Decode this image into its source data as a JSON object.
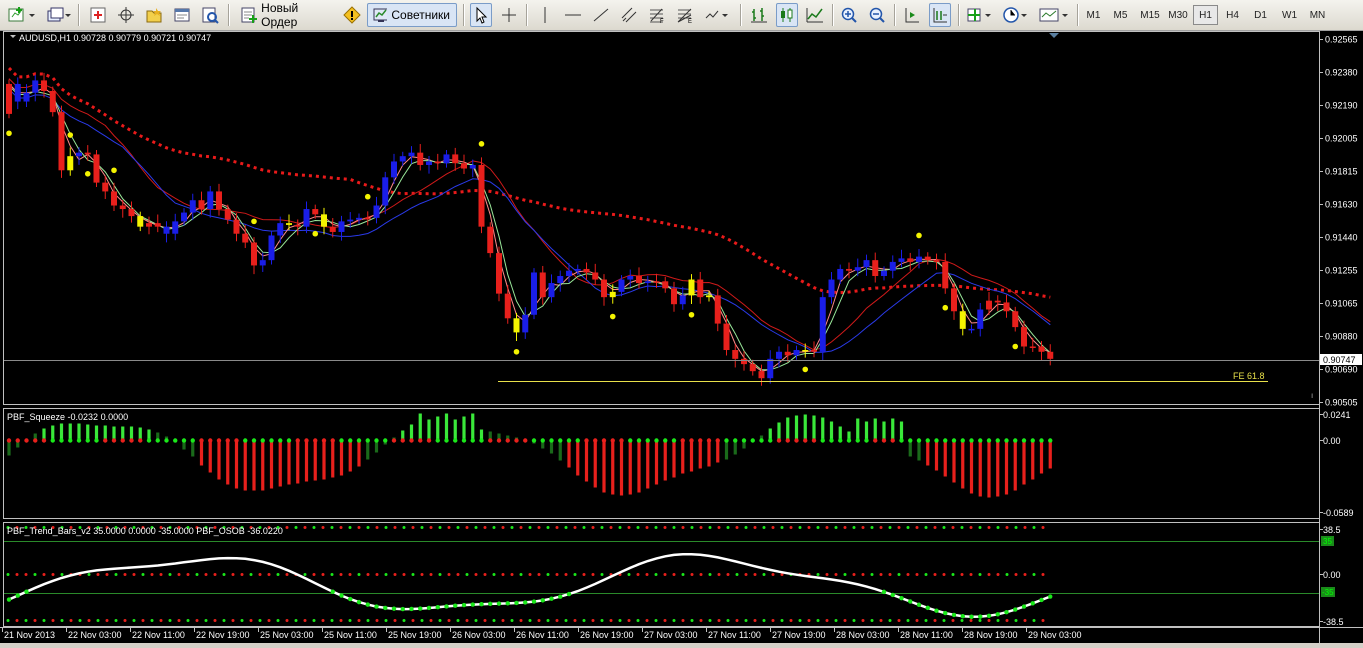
{
  "toolbar": {
    "new_order_label": "Новый Ордер",
    "advisors_label": "Советники",
    "timeframes": [
      "M1",
      "M5",
      "M15",
      "M30",
      "H1",
      "H4",
      "D1",
      "W1",
      "MN"
    ],
    "active_timeframe": "H1"
  },
  "main_chart": {
    "header": "AUDUSD,H1  0.90728 0.90779 0.90721 0.90747",
    "price_ticks": [
      "0.92565",
      "0.92380",
      "0.92190",
      "0.92005",
      "0.91815",
      "0.91630",
      "0.91440",
      "0.91255",
      "0.91065",
      "0.90880",
      "0.90690",
      "0.90505"
    ],
    "current_price": "0.90747",
    "fib_label": "FE 61.8",
    "candles_o": [
      0.9214,
      0.9231,
      0.9221,
      0.9226,
      0.9233,
      0.9227,
      0.9215,
      0.9182,
      0.919,
      0.9192,
      0.9191,
      0.9175,
      0.917,
      0.9162,
      0.916,
      0.9156,
      0.915,
      0.9152,
      0.915,
      0.9146,
      0.9153,
      0.9158,
      0.9165,
      0.916,
      0.917,
      0.916,
      0.9154,
      0.9146,
      0.9141,
      0.9128,
      0.9131,
      0.9145,
      0.9152,
      0.9151,
      0.915,
      0.916,
      0.9157,
      0.915,
      0.9147,
      0.9153,
      0.9154,
      0.9155,
      0.9155,
      0.9162,
      0.9178,
      0.9187,
      0.919,
      0.9192,
      0.9185,
      0.9187,
      0.9186,
      0.9191,
      0.9186,
      0.9183,
      0.9185,
      0.915,
      0.9135,
      0.9112,
      0.9098,
      0.909,
      0.91,
      0.9124,
      0.911,
      0.9118,
      0.9122,
      0.9125,
      0.9126,
      0.9124,
      0.912,
      0.911,
      0.9113,
      0.912,
      0.9122,
      0.9118,
      0.9119,
      0.9119,
      0.9115,
      0.9106,
      0.9111,
      0.912,
      0.911,
      0.9111,
      0.9095,
      0.908,
      0.9075,
      0.9072,
      0.9068,
      0.9064,
      0.9075,
      0.9079,
      0.9077,
      0.908,
      0.908,
      0.9079,
      0.911,
      0.912,
      0.9126,
      0.9125,
      0.9127,
      0.9131,
      0.9122,
      0.9125,
      0.913,
      0.9132,
      0.913,
      0.9133,
      0.9131,
      0.913,
      0.9115,
      0.9102,
      0.9092,
      0.9092,
      0.9103,
      0.9108,
      0.9107,
      0.9102,
      0.9093,
      0.9082,
      0.9082,
      0.9079
    ],
    "candles_c": [
      0.9231,
      0.9221,
      0.9226,
      0.9233,
      0.9227,
      0.9215,
      0.9182,
      0.919,
      0.9192,
      0.9191,
      0.9175,
      0.917,
      0.9162,
      0.916,
      0.9156,
      0.915,
      0.9152,
      0.915,
      0.9146,
      0.9153,
      0.9158,
      0.9165,
      0.916,
      0.917,
      0.916,
      0.9154,
      0.9146,
      0.9141,
      0.9128,
      0.9131,
      0.9145,
      0.9152,
      0.9151,
      0.915,
      0.916,
      0.9157,
      0.915,
      0.9147,
      0.9153,
      0.9154,
      0.9155,
      0.9155,
      0.9162,
      0.9178,
      0.9187,
      0.919,
      0.9192,
      0.9185,
      0.9187,
      0.9186,
      0.9191,
      0.9186,
      0.9183,
      0.9185,
      0.915,
      0.9135,
      0.9112,
      0.9098,
      0.909,
      0.91,
      0.9124,
      0.911,
      0.9118,
      0.9122,
      0.9125,
      0.9126,
      0.9124,
      0.912,
      0.911,
      0.9113,
      0.912,
      0.9122,
      0.9118,
      0.9119,
      0.9119,
      0.9115,
      0.9106,
      0.9111,
      0.912,
      0.911,
      0.9111,
      0.9095,
      0.908,
      0.9075,
      0.9072,
      0.9068,
      0.9064,
      0.9075,
      0.9079,
      0.9077,
      0.908,
      0.908,
      0.9079,
      0.911,
      0.912,
      0.9126,
      0.9125,
      0.9127,
      0.9131,
      0.9122,
      0.9125,
      0.913,
      0.9132,
      0.913,
      0.9133,
      0.9131,
      0.913,
      0.9115,
      0.9102,
      0.9092,
      0.9092,
      0.9103,
      0.9108,
      0.9107,
      0.9102,
      0.9093,
      0.9082,
      0.9082,
      0.9079,
      0.9075
    ],
    "candle_color": [
      "red",
      "blue",
      "blue",
      "blue",
      "red",
      "red",
      "red",
      "blue",
      "blue",
      "red",
      "red",
      "red",
      "red",
      "red",
      "red",
      "blue",
      "red",
      "red",
      "blue",
      "blue",
      "blue",
      "blue",
      "red",
      "blue",
      "red",
      "red",
      "red",
      "red",
      "red",
      "blue",
      "blue",
      "blue",
      "red",
      "red",
      "blue",
      "red",
      "red",
      "red",
      "blue",
      "blue",
      "blue",
      "red",
      "blue",
      "blue",
      "blue",
      "blue",
      "blue",
      "red",
      "blue",
      "red",
      "blue",
      "red",
      "red",
      "blue",
      "red",
      "red",
      "red",
      "red",
      "red",
      "blue",
      "blue",
      "red",
      "blue",
      "blue",
      "blue",
      "blue",
      "red",
      "red",
      "red",
      "blue",
      "blue",
      "blue",
      "red",
      "blue",
      "red",
      "red",
      "red",
      "blue",
      "blue",
      "red",
      "blue",
      "red",
      "red",
      "red",
      "red",
      "red",
      "red",
      "blue",
      "blue",
      "red",
      "blue",
      "red",
      "red",
      "blue",
      "blue",
      "blue",
      "red",
      "blue",
      "blue",
      "red",
      "blue",
      "blue",
      "blue",
      "red",
      "blue",
      "red",
      "red",
      "red",
      "red",
      "red",
      "blue",
      "blue",
      "red",
      "red",
      "red",
      "red",
      "red",
      "red",
      "red",
      "red"
    ]
  },
  "squeeze_pane": {
    "header": "PBF_Squeeze -0.0232 0.0000",
    "ticks": [
      "0.0241",
      "0.00",
      "-0.0589"
    ]
  },
  "trend_pane": {
    "header": "PBF_Trend_Bars_v2 35.0000 0.0000 -35.0000  PBF_OSOB -36.0220",
    "ticks": [
      "38.5",
      "0.00",
      "-38.5"
    ],
    "level_up": "35",
    "level_down": "-35"
  },
  "time_axis": [
    "21 Nov 2013",
    "22 Nov 03:00",
    "22 Nov 11:00",
    "22 Nov 19:00",
    "25 Nov 03:00",
    "25 Nov 11:00",
    "25 Nov 19:00",
    "26 Nov 03:00",
    "26 Nov 11:00",
    "26 Nov 19:00",
    "27 Nov 03:00",
    "27 Nov 11:00",
    "27 Nov 19:00",
    "28 Nov 03:00",
    "28 Nov 11:00",
    "28 Nov 19:00",
    "29 Nov 03:00"
  ]
}
